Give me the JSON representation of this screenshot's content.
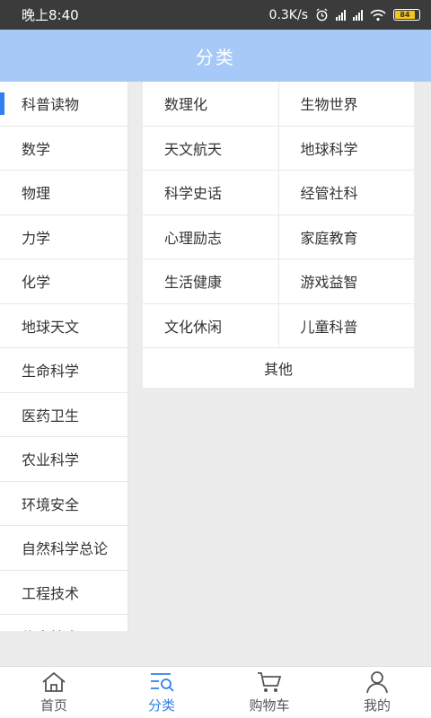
{
  "status": {
    "time": "晚上8:40",
    "speed": "0.3K/s",
    "battery": "84"
  },
  "header": {
    "title": "分类"
  },
  "sidebar": {
    "items": [
      {
        "label": "科普读物",
        "active": true
      },
      {
        "label": "数学"
      },
      {
        "label": "物理"
      },
      {
        "label": "力学"
      },
      {
        "label": "化学"
      },
      {
        "label": "地球天文"
      },
      {
        "label": "生命科学"
      },
      {
        "label": "医药卫生"
      },
      {
        "label": "农业科学"
      },
      {
        "label": "环境安全"
      },
      {
        "label": "自然科学总论"
      },
      {
        "label": "工程技术"
      },
      {
        "label": "信息技术"
      }
    ]
  },
  "subcategories": {
    "rows": [
      [
        "数理化",
        "生物世界"
      ],
      [
        "天文航天",
        "地球科学"
      ],
      [
        "科学史话",
        "经管社科"
      ],
      [
        "心理励志",
        "家庭教育"
      ],
      [
        "生活健康",
        "游戏益智"
      ],
      [
        "文化休闲",
        "儿童科普"
      ]
    ],
    "last": "其他"
  },
  "tabbar": {
    "items": [
      {
        "label": "首页",
        "icon": "home-icon"
      },
      {
        "label": "分类",
        "icon": "category-icon",
        "active": true
      },
      {
        "label": "购物车",
        "icon": "cart-icon"
      },
      {
        "label": "我的",
        "icon": "profile-icon"
      }
    ]
  }
}
